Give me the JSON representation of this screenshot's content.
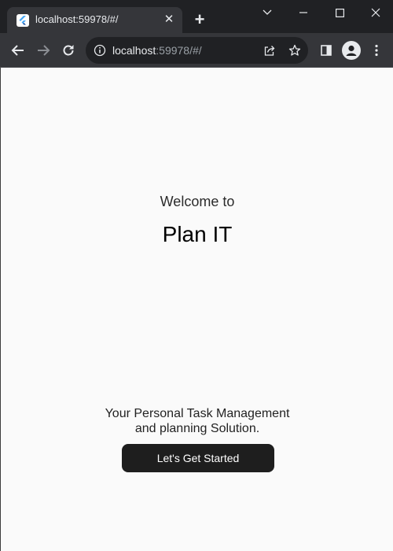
{
  "browser": {
    "tab_title": "localhost:59978/#/",
    "tab_close": "✕",
    "new_tab": "+",
    "url_host": "localhost",
    "url_path": ":59978/#/"
  },
  "icons": {
    "favicon": "flutter-logo-icon",
    "back": "arrow-left-icon",
    "forward": "arrow-right-icon",
    "reload": "reload-icon",
    "info": "info-icon",
    "share": "share-icon",
    "bookmark": "star-icon",
    "side_panel": "side-panel-icon",
    "profile": "profile-icon",
    "menu": "kebab-menu-icon"
  },
  "page": {
    "welcome": "Welcome to",
    "title": "Plan IT",
    "tagline_line1": "Your Personal Task Management",
    "tagline_line2": "and planning Solution.",
    "cta_label": "Let's Get Started"
  },
  "colors": {
    "chrome_dark": "#202124",
    "chrome_tab": "#35363a",
    "page_bg": "#fafafa",
    "button_bg": "#1e1e1e",
    "button_text": "#ffffff"
  }
}
